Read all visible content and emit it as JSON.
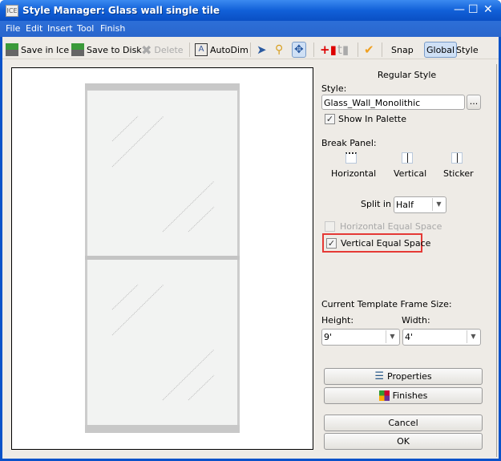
{
  "window": {
    "title": "Style Manager: Glass wall single tile",
    "app_icon": "ICE"
  },
  "menu": [
    "File",
    "Edit",
    "Insert",
    "Tool",
    "Finish"
  ],
  "toolbar": {
    "save_in_ice": "Save in Ice",
    "save_to_disk": "Save to Disk",
    "delete": "Delete",
    "autodim": "AutoDim",
    "snap": "Snap",
    "global": "Global",
    "style": "Style"
  },
  "panel": {
    "heading": "Regular Style",
    "style_label": "Style:",
    "style_value": "Glass_Wall_Monolithic",
    "browse": "...",
    "show_in_palette": "Show In Palette",
    "show_in_palette_checked": true,
    "break_panel_label": "Break Panel:",
    "break_options": [
      "Horizontal",
      "Vertical",
      "Sticker"
    ],
    "split_label": "Split in",
    "split_value": "Half",
    "horizontal_equal_space": "Horizontal Equal Space",
    "horizontal_equal_space_checked": false,
    "horizontal_equal_space_enabled": false,
    "vertical_equal_space": "Vertical Equal Space",
    "vertical_equal_space_checked": true,
    "frame_size_label": "Current Template Frame Size:",
    "height_label": "Height:",
    "height_value": "9'",
    "width_label": "Width:",
    "width_value": "4'",
    "properties": "Properties",
    "finishes": "Finishes",
    "cancel": "Cancel",
    "ok": "OK"
  },
  "colors": {
    "highlight": "#e53935",
    "title_bar": "#1160d8"
  }
}
